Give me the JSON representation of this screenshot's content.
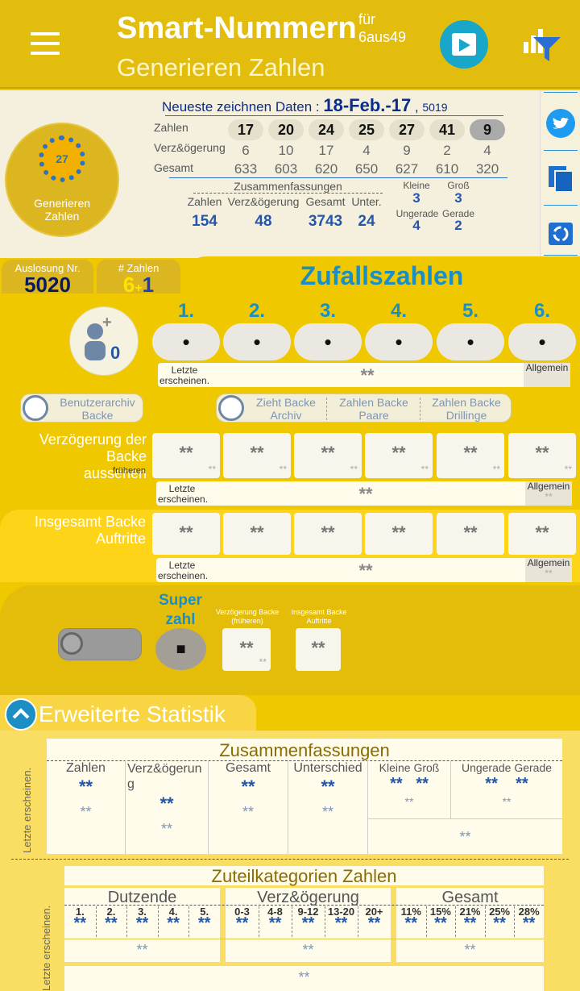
{
  "header": {
    "app_title": "Smart-Nummern",
    "fur": "für",
    "game": "6aus49",
    "subtitle": "Generieren Zahlen"
  },
  "info": {
    "newest_label": "Neueste zeichnen Daten :",
    "date": "18-Feb.-17",
    "sep": ",",
    "draw_no": "5019",
    "row_labels": [
      "Zahlen",
      "Verz&ögerung",
      "Gesamt"
    ],
    "numbers": [
      "17",
      "20",
      "24",
      "25",
      "27",
      "41",
      "9"
    ],
    "delays": [
      "6",
      "10",
      "17",
      "4",
      "9",
      "2",
      "4"
    ],
    "totals": [
      "633",
      "603",
      "620",
      "650",
      "627",
      "610",
      "320"
    ],
    "summaries_label": "Zusammenfassungen",
    "sum_heads": [
      "Zahlen",
      "Verz&ögerung",
      "Gesamt",
      "Unter."
    ],
    "sum_vals": [
      "154",
      "48",
      "3743",
      "24"
    ],
    "kleine_label": "Kleine",
    "kleine": "3",
    "gross_label": "Groß",
    "gross": "3",
    "ungerade_label": "Ungerade",
    "ungerade": "4",
    "gerade_label": "Gerade",
    "gerade": "2"
  },
  "generate_button": {
    "line1": "Generieren",
    "line2": "Zahlen"
  },
  "tabs": {
    "auslosung_label": "Auslosung Nr.",
    "auslosung": "5020",
    "zahlen_label": "# Zahlen",
    "zahlen_a": "6",
    "zahlen_plus": "+",
    "zahlen_b": "1",
    "zufall": "Zufallszahlen"
  },
  "user_count": "0",
  "plus": "+",
  "columns": [
    "1.",
    "2.",
    "3.",
    "4.",
    "5.",
    "6."
  ],
  "ball": "•",
  "stars": "**",
  "last_label": "Letzte erscheinen.",
  "allg_label": "Allgemein",
  "buttons": {
    "benutzer_line1": "Benutzerarchiv",
    "benutzer_line2": "Backe",
    "zieht_line1": "Zieht Backe",
    "zieht_line2": "Archiv",
    "paare_line1": "Zahlen Backe",
    "paare_line2": "Paare",
    "drill_line1": "Zahlen Backe",
    "drill_line2": "Drillinge"
  },
  "sections": {
    "delay_line1": "Verzögerung der Backe",
    "delay_line2": "aussehen",
    "delay_note": "früheren",
    "total_line1": "Insgesamt Backe",
    "total_line2": "Auftritte"
  },
  "super": {
    "label_line1": "Super",
    "label_line2": "zahl",
    "value": "■",
    "archiv_line1": "Zieht Backe",
    "archiv_line2": "Archiv",
    "delay_head1": "Verzögerung Backe",
    "delay_head2": "(früheren)",
    "total_head1": "Insgesamt Backe",
    "total_head2": "Auftritte"
  },
  "stats": {
    "title": "Erweiterte Statistik",
    "summary_title": "Zusammenfassungen",
    "cols": [
      "Zahlen",
      "Verz&ögerun",
      "g",
      "Gesamt",
      "Unterschied"
    ],
    "kleine": "Kleine",
    "gross": "Groß",
    "ungerade": "Ungerade",
    "gerade": "Gerade",
    "vert_label": "Letzte erscheinen.",
    "cat_title": "Zuteilkategorien Zahlen",
    "dutzende": "Dutzende",
    "verz": "Verz&ögerung",
    "gesamt": "Gesamt",
    "dut_cols": [
      "1.",
      "2.",
      "3.",
      "4.",
      "5."
    ],
    "verz_cols": [
      "0-3",
      "4-8",
      "9-12",
      "13-20",
      "20+"
    ],
    "ges_cols": [
      "11%",
      "15%",
      "21%",
      "25%",
      "28%"
    ]
  },
  "colors": {
    "accent": "#1b8fc4",
    "bg": "#f0c800",
    "numbers": "#2556a8"
  }
}
